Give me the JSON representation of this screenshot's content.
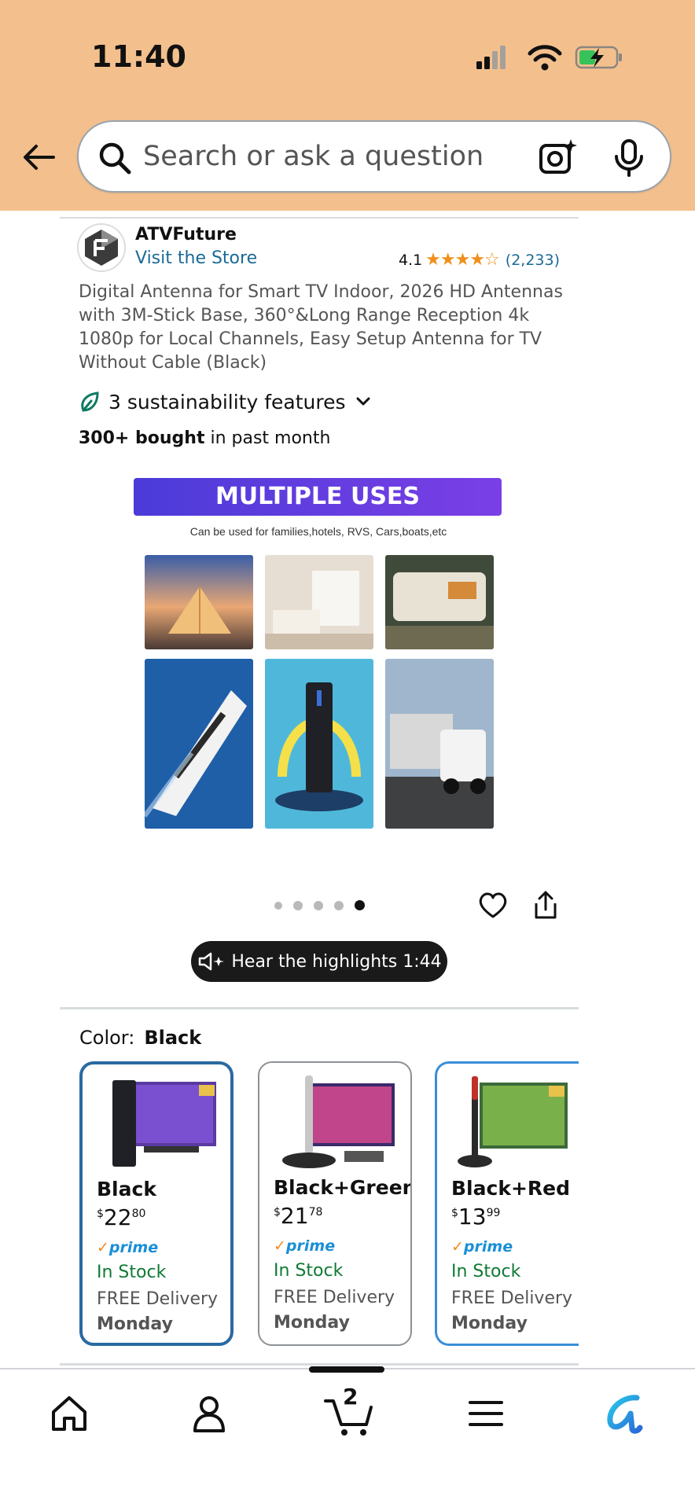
{
  "status_bar": {
    "time": "11:40"
  },
  "search": {
    "placeholder": "Search or ask a question"
  },
  "seller": {
    "name": "ATVFuture",
    "visit_label": "Visit the Store"
  },
  "rating": {
    "value": "4.1",
    "stars": "★★★★☆",
    "count": "(2,233)"
  },
  "product": {
    "title": "Digital Antenna for Smart TV Indoor, 2026 HD Antennas with 3M-Stick Base, 360°&Long Range Reception 4k 1080p for Local Channels, Easy Setup Antenna for TV Without Cable (Black)",
    "sustainability": "3 sustainability features",
    "bought_bold": "300+ bought",
    "bought_rest": " in past month"
  },
  "gallery": {
    "banner": "MULTIPLE USES",
    "subtitle": "Can be used for families,hotels, RVS, Cars,boats,etc",
    "dots_total": 5,
    "active_dot": 5
  },
  "highlights": {
    "label": "Hear the highlights 1:44"
  },
  "color": {
    "label": "Color:",
    "selected": "Black"
  },
  "variants": [
    {
      "name": "Black",
      "price_symbol": "$",
      "price_whole": "22",
      "price_cents": "80",
      "prime": "prime",
      "stock": "In Stock",
      "delivery": "FREE Delivery",
      "day": "Monday"
    },
    {
      "name": "Black+Green",
      "price_symbol": "$",
      "price_whole": "21",
      "price_cents": "78",
      "prime": "prime",
      "stock": "In Stock",
      "delivery": "FREE Delivery",
      "day": "Monday"
    },
    {
      "name": "Black+Red",
      "price_symbol": "$",
      "price_whole": "13",
      "price_cents": "99",
      "prime": "prime",
      "stock": "In Stock",
      "delivery": "FREE Delivery",
      "day": "Monday"
    }
  ],
  "nav": {
    "cart_count": "2",
    "items": [
      "home-icon",
      "account-icon",
      "cart-icon",
      "menu-icon",
      "rufus-icon"
    ]
  },
  "colors": {
    "header_bg": "#f3c08d",
    "link": "#1b6a96",
    "star": "#f08f1a",
    "in_stock": "#0f7a34",
    "prime": "#1a8fd6",
    "selected_border": "#2a6aa0"
  }
}
